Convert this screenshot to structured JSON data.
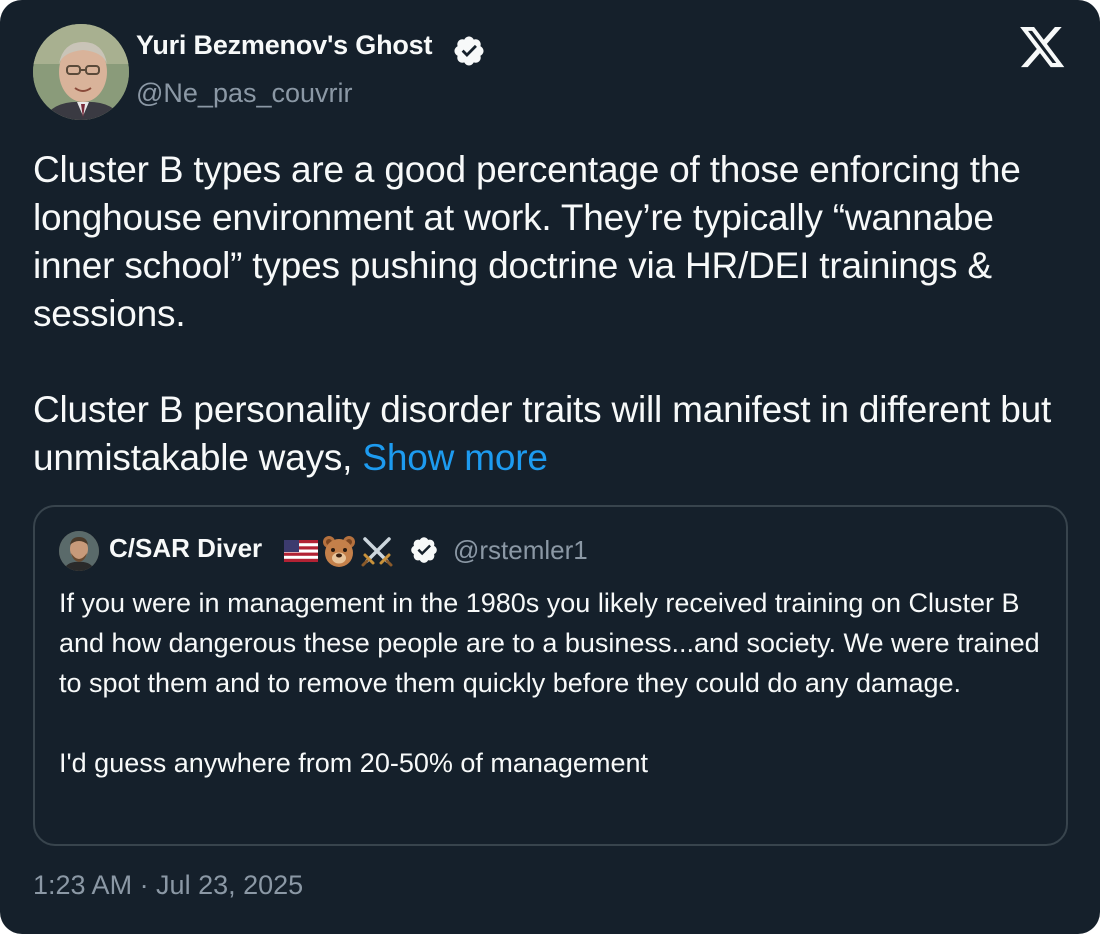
{
  "author": {
    "name": "Yuri Bezmenov's Ghost",
    "handle": "@Ne_pas_couvrir",
    "verified": true
  },
  "platform_logo": "x-logo-icon",
  "tweet": {
    "paragraphs": [
      "Cluster B types are a good percentage of those enforcing the longhouse environment at work.  They’re typically “wannabe inner school” types pushing doctrine via HR/DEI trainings & sessions.",
      "Cluster B personality disorder traits will manifest in different but unmistakable ways,"
    ],
    "show_more": "Show more"
  },
  "quote": {
    "name": "C/SAR Diver",
    "emojis": [
      "us-flag-icon",
      "bear-face-icon",
      "crossed-swords-icon"
    ],
    "handle": "@rstemler1",
    "verified": true,
    "paragraphs": [
      "If you were in management in the 1980s you likely received training on Cluster B and how dangerous these people are to a business...and society. We were trained to spot them and to remove them quickly before they could do any damage.",
      "I'd guess anywhere from 20-50% of management"
    ]
  },
  "timestamp": "1:23 AM · Jul 23, 2025",
  "colors": {
    "background": "#15202b",
    "text": "#f7f9f9",
    "secondary_text": "#8b98a5",
    "link": "#1d9bf0",
    "border": "#38444d"
  }
}
